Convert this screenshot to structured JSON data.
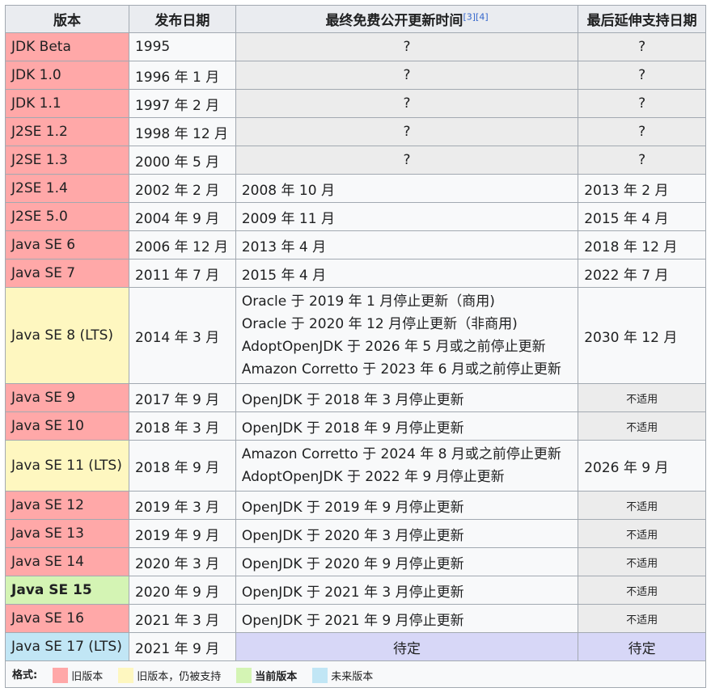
{
  "headers": {
    "version": "版本",
    "release": "发布日期",
    "last_public": "最终免费公开更新时间",
    "ref3": "[3]",
    "ref4": "[4]",
    "extended": "最后延伸支持日期"
  },
  "rows": [
    {
      "status": "old",
      "version": "JDK Beta",
      "release": "1995",
      "updates": [
        "?"
      ],
      "extended": "?",
      "upd_kind": "unknown",
      "ext_kind": "unknown"
    },
    {
      "status": "old",
      "version": "JDK 1.0",
      "release": "1996 年 1 月",
      "updates": [
        "?"
      ],
      "extended": "?",
      "upd_kind": "unknown",
      "ext_kind": "unknown"
    },
    {
      "status": "old",
      "version": "JDK 1.1",
      "release": "1997 年 2 月",
      "updates": [
        "?"
      ],
      "extended": "?",
      "upd_kind": "unknown",
      "ext_kind": "unknown"
    },
    {
      "status": "old",
      "version": "J2SE 1.2",
      "release": "1998 年 12 月",
      "updates": [
        "?"
      ],
      "extended": "?",
      "upd_kind": "unknown",
      "ext_kind": "unknown"
    },
    {
      "status": "old",
      "version": "J2SE 1.3",
      "release": "2000 年 5 月",
      "updates": [
        "?"
      ],
      "extended": "?",
      "upd_kind": "unknown",
      "ext_kind": "unknown"
    },
    {
      "status": "old",
      "version": "J2SE 1.4",
      "release": "2002 年 2 月",
      "updates": [
        "2008 年 10 月"
      ],
      "extended": "2013 年 2 月",
      "upd_kind": "text",
      "ext_kind": "text"
    },
    {
      "status": "old",
      "version": "J2SE 5.0",
      "release": "2004 年 9 月",
      "updates": [
        "2009 年 11 月"
      ],
      "extended": "2015 年 4 月",
      "upd_kind": "text",
      "ext_kind": "text"
    },
    {
      "status": "old",
      "version": "Java SE 6",
      "release": "2006 年 12 月",
      "updates": [
        "2013 年 4 月"
      ],
      "extended": "2018 年 12 月",
      "upd_kind": "text",
      "ext_kind": "text"
    },
    {
      "status": "old",
      "version": "Java SE 7",
      "release": "2011 年 7 月",
      "updates": [
        "2015 年 4 月"
      ],
      "extended": "2022 年 7 月",
      "upd_kind": "text",
      "ext_kind": "text"
    },
    {
      "status": "lts",
      "version": "Java SE 8 (LTS)",
      "release": "2014 年 3 月",
      "updates": [
        "Oracle 于 2019 年 1 月停止更新（商用)",
        "Oracle 于 2020 年 12 月停止更新（非商用)",
        "AdoptOpenJDK 于 2026 年 5 月或之前停止更新",
        "Amazon Corretto 于 2023 年 6 月或之前停止更新"
      ],
      "extended": "2030 年 12 月",
      "upd_kind": "text",
      "ext_kind": "text"
    },
    {
      "status": "old",
      "version": "Java SE 9",
      "release": "2017 年 9 月",
      "updates": [
        "OpenJDK 于 2018 年 3 月停止更新"
      ],
      "extended": "不适用",
      "upd_kind": "text",
      "ext_kind": "na"
    },
    {
      "status": "old",
      "version": "Java SE 10",
      "release": "2018 年 3 月",
      "updates": [
        "OpenJDK 于 2018 年 9 月停止更新"
      ],
      "extended": "不适用",
      "upd_kind": "text",
      "ext_kind": "na"
    },
    {
      "status": "lts",
      "version": "Java SE 11 (LTS)",
      "release": "2018 年 9 月",
      "updates": [
        "Amazon Corretto 于 2024 年 8 月或之前停止更新",
        "AdoptOpenJDK 于 2022 年 9 月停止更新"
      ],
      "extended": "2026 年 9 月",
      "upd_kind": "text",
      "ext_kind": "text"
    },
    {
      "status": "old",
      "version": "Java SE 12",
      "release": "2019 年 3 月",
      "updates": [
        "OpenJDK 于 2019 年 9 月停止更新"
      ],
      "extended": "不适用",
      "upd_kind": "text",
      "ext_kind": "na"
    },
    {
      "status": "old",
      "version": "Java SE 13",
      "release": "2019 年 9 月",
      "updates": [
        "OpenJDK 于 2020 年 3 月停止更新"
      ],
      "extended": "不适用",
      "upd_kind": "text",
      "ext_kind": "na"
    },
    {
      "status": "old",
      "version": "Java SE 14",
      "release": "2020 年 3 月",
      "updates": [
        "OpenJDK 于 2020 年 9 月停止更新"
      ],
      "extended": "不适用",
      "upd_kind": "text",
      "ext_kind": "na"
    },
    {
      "status": "cur",
      "version": "Java SE 15",
      "release": "2020 年 9 月",
      "updates": [
        "OpenJDK 于 2021 年 3 月停止更新"
      ],
      "extended": "不适用",
      "upd_kind": "text",
      "ext_kind": "na"
    },
    {
      "status": "old",
      "version": "Java SE 16",
      "release": "2021 年 3 月",
      "updates": [
        "OpenJDK 于 2021 年 9 月停止更新"
      ],
      "extended": "不适用",
      "upd_kind": "text",
      "ext_kind": "na"
    },
    {
      "status": "fut",
      "version": "Java SE 17 (LTS)",
      "release": "2021 年 9 月",
      "updates": [
        "待定"
      ],
      "extended": "待定",
      "upd_kind": "pending",
      "ext_kind": "pending"
    }
  ],
  "legend": {
    "label": "格式:",
    "items": [
      {
        "status": "old",
        "text": "旧版本"
      },
      {
        "status": "lts",
        "text": "旧版本，仍被支持"
      },
      {
        "status": "cur",
        "text": "当前版本"
      },
      {
        "status": "fut",
        "text": "未来版本"
      }
    ]
  },
  "colors": {
    "old": "#ffa8a8",
    "lts": "#fef7c0",
    "cur": "#d4f4b4",
    "fut": "#c1e6f5",
    "unknown_or_na": "#ececec",
    "pending": "#d7d7f7",
    "header": "#eaecf0"
  }
}
